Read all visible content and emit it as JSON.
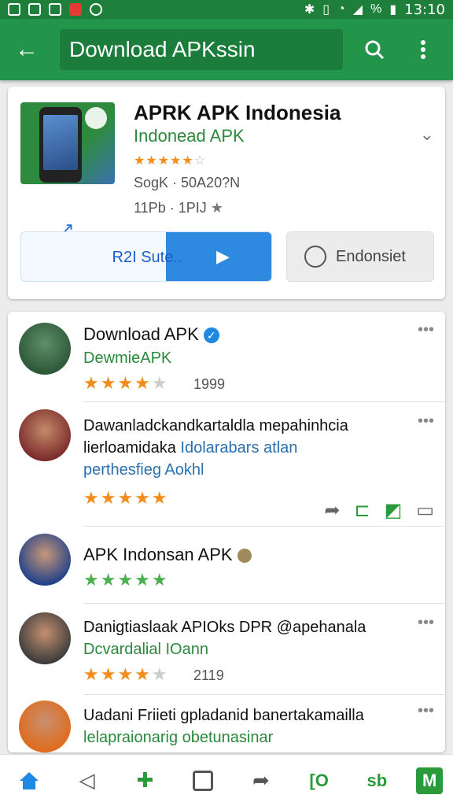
{
  "status_bar": {
    "time": "13:10",
    "battery": "%"
  },
  "app_bar": {
    "search_value": "Download APKssin"
  },
  "app_card": {
    "title": "APRK APK Indonesia",
    "subtitle": "Indonead APK",
    "meta1": "SogK · 50A20?N",
    "meta2": "11Pb · 1PIJ",
    "install_label": "R2I Sute..",
    "install_progress": 0.58,
    "second_button_label": "Endonsiet",
    "rating_stars": 4.5
  },
  "list": [
    {
      "title": "Download APK",
      "subtitle": "DewmieAPK",
      "stars": 4,
      "count": "1999"
    },
    {
      "text_line1": "Dawanladckandkartaldla mepahinhcia",
      "text_line2_a": "lierloamidaka",
      "text_line2_b": "Idolarabars atlan",
      "text_line3": "perthesfieg Aokhl",
      "stars": 5
    },
    {
      "title": "APK Indonsan APK",
      "stars": 5
    },
    {
      "title": "Danigtiaslaak APIOks DPR @apehanala",
      "subtitle": "Dcvardalial IOann",
      "stars": 4,
      "count": "2119"
    },
    {
      "title": "Uadani Friieti gpladanid banertakamailla",
      "subtitle": "lelapraionarig obetunasinar"
    }
  ],
  "icons": {
    "back": "arrow-left",
    "search": "magnifier",
    "more": "vertical-dots",
    "nav": [
      "home",
      "back-triangle",
      "plus",
      "square",
      "share",
      "quote",
      "sb",
      "m"
    ]
  },
  "colors": {
    "app_bar": "#22954a",
    "accent_green": "#2a8a3c",
    "star_orange": "#f28c1a",
    "install_blue": "#2d8ae0"
  }
}
